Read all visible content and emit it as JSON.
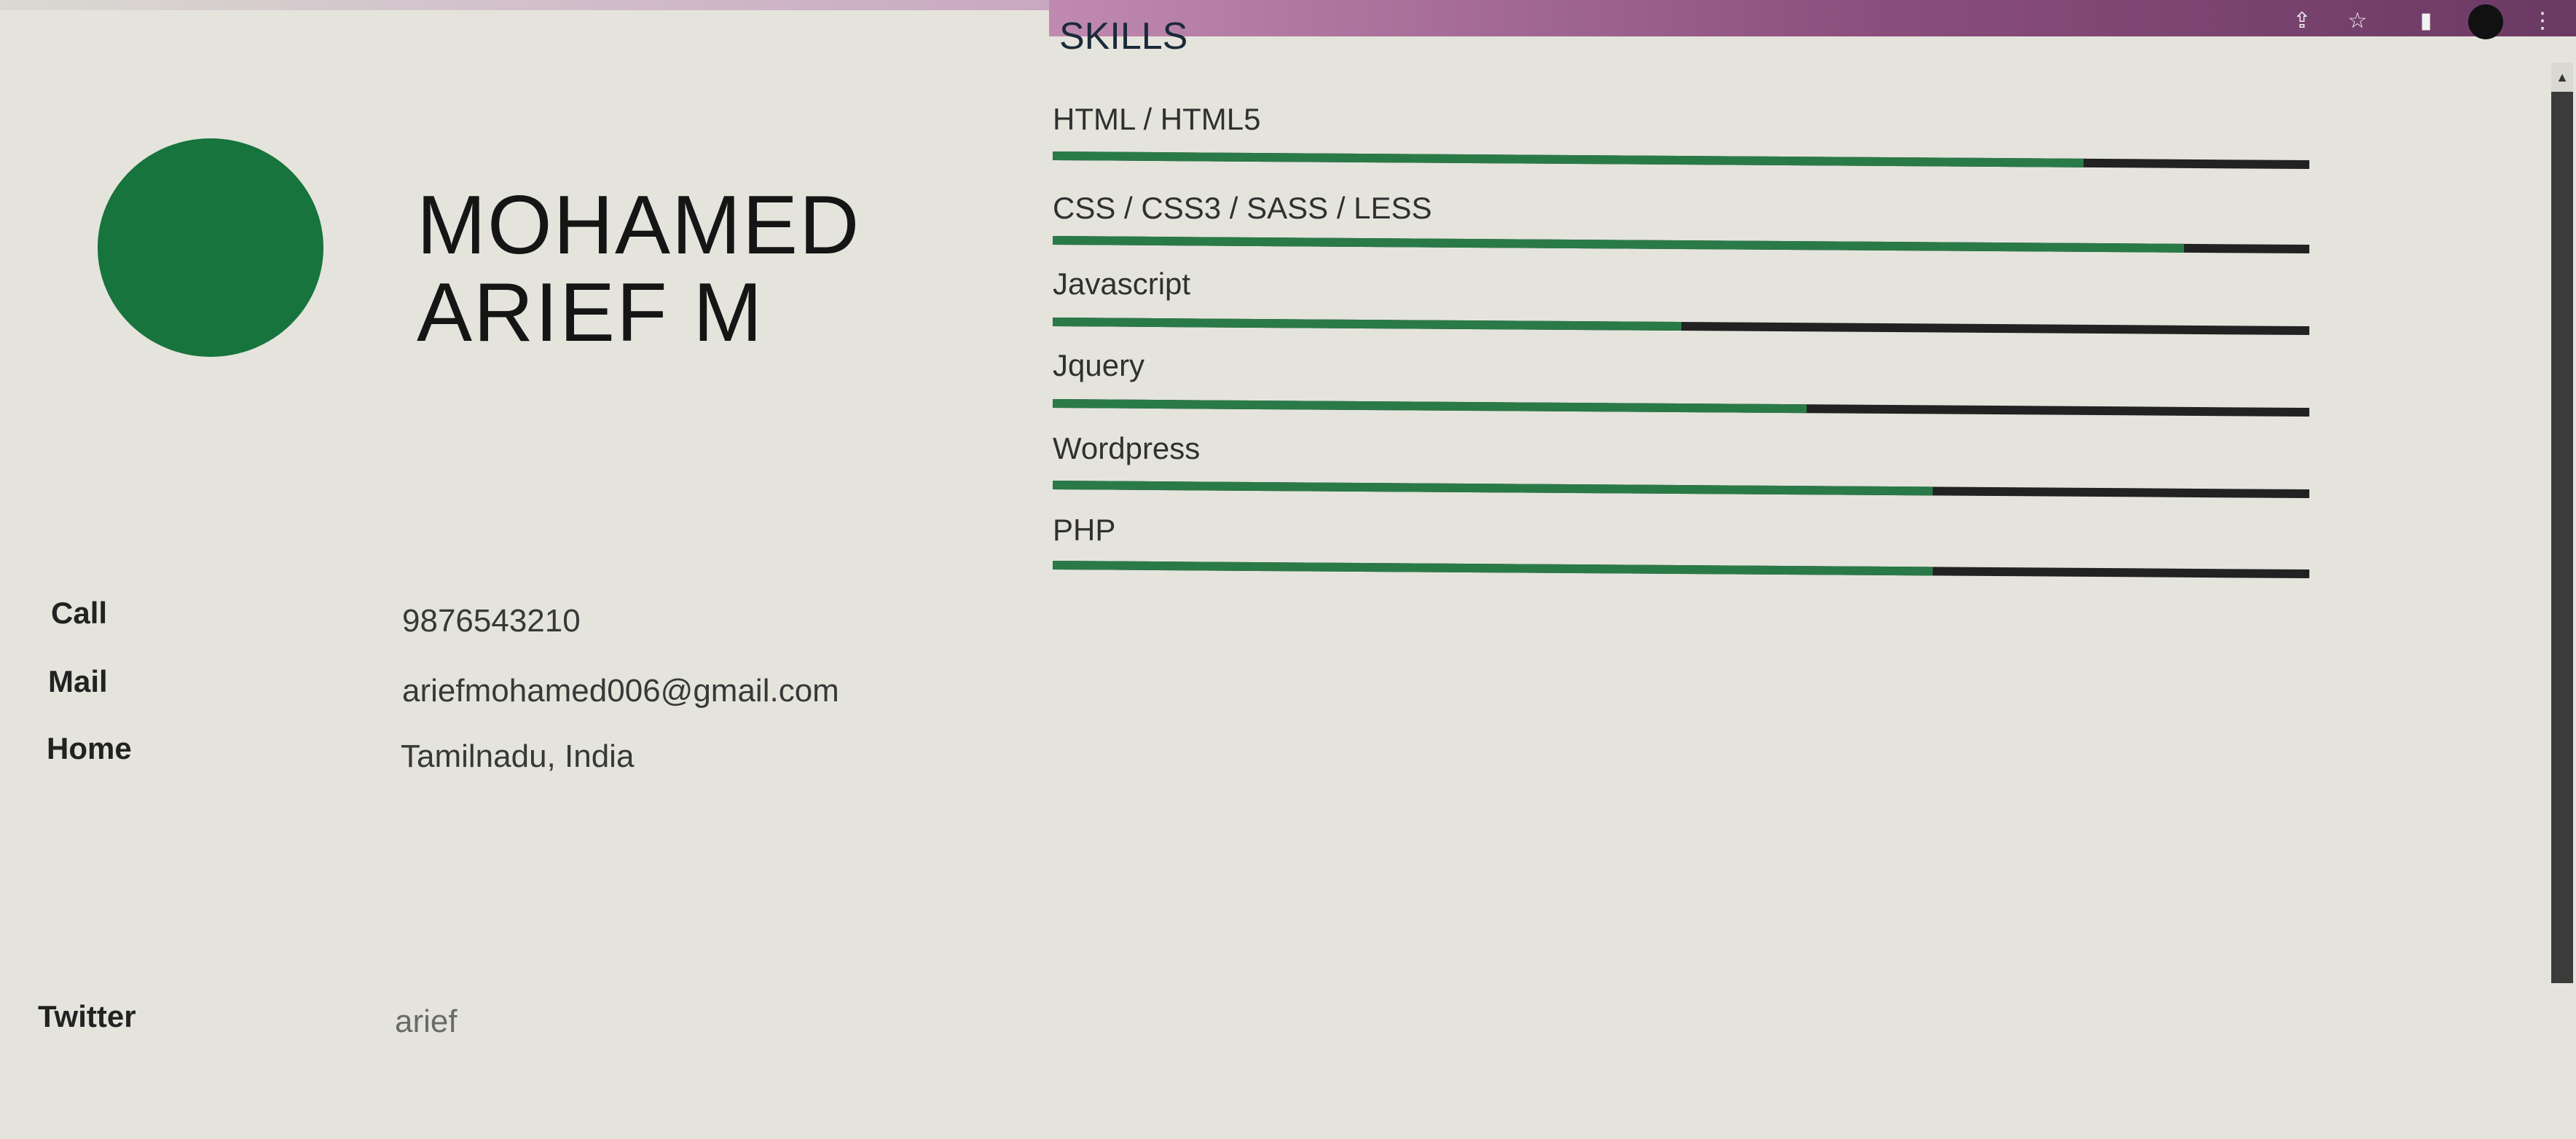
{
  "profile": {
    "first_name": "MOHAMED",
    "last_name": "ARIEF M",
    "avatar_color": "#17743c"
  },
  "skills": {
    "title": "SKILLS",
    "items": [
      {
        "label": "HTML / HTML5",
        "level": 0.82
      },
      {
        "label": "CSS / CSS3 / SASS / LESS",
        "level": 0.9
      },
      {
        "label": "Javascript",
        "level": 0.5
      },
      {
        "label": "Jquery",
        "level": 0.6
      },
      {
        "label": "Wordpress",
        "level": 0.7
      },
      {
        "label": "PHP",
        "level": 0.7
      }
    ],
    "fill_color": "#2a7a48",
    "track_color": "#222222"
  },
  "contact": {
    "call_label": "Call",
    "call_value": "9876543210",
    "mail_label": "Mail",
    "mail_value": "ariefmohamed006@gmail.com",
    "home_label": "Home",
    "home_value": "Tamilnadu, India",
    "twitter_label": "Twitter",
    "twitter_value": "arief"
  },
  "browser": {
    "icons": [
      "share-icon",
      "star-icon",
      "sidebar-icon",
      "profile-avatar",
      "menu-icon"
    ],
    "menu_glyph": "⋮",
    "star_glyph": "☆",
    "share_glyph": "⇪",
    "panel_glyph": "▮"
  }
}
